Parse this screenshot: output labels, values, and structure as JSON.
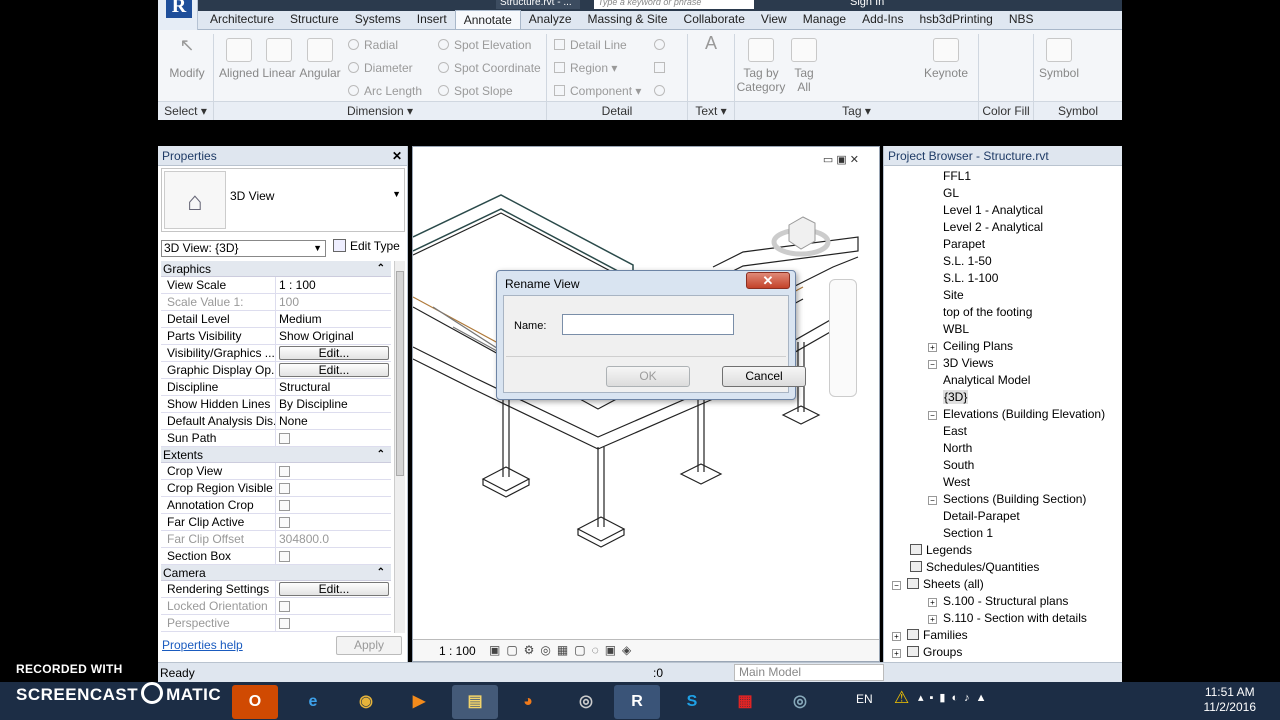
{
  "titlebar": {
    "file": "Structure.rvt - ...",
    "search_placeholder": "Type a keyword or phrase",
    "signin": "Sign In"
  },
  "tabs": [
    "Architecture",
    "Structure",
    "Systems",
    "Insert",
    "Annotate",
    "Analyze",
    "Massing & Site",
    "Collaborate",
    "View",
    "Manage",
    "Add-Ins",
    "hsb3dPrinting",
    "NBS"
  ],
  "active_tab": "Annotate",
  "ribbon": {
    "select": {
      "modify": "Modify",
      "panel": "Select ▾"
    },
    "dimension": {
      "aligned": "Aligned",
      "linear": "Linear",
      "angular": "Angular",
      "radial": "Radial",
      "diameter": "Diameter",
      "arc_length": "Arc Length",
      "spot_elevation": "Spot Elevation",
      "spot_coordinate": "Spot Coordinate",
      "spot_slope": "Spot Slope",
      "panel": "Dimension ▾"
    },
    "detail": {
      "detail_line": "Detail Line",
      "region": "Region ▾",
      "component": "Component ▾",
      "panel": "Detail"
    },
    "text": {
      "label": "Text ▾"
    },
    "tag": {
      "tag_by_category": "Tag by Category",
      "tag_all": "Tag All",
      "keynote": "Keynote",
      "panel": "Tag ▾"
    },
    "color_fill": {
      "panel": "Color Fill"
    },
    "symbol": {
      "symbol": "Symbol",
      "panel": "Symbol"
    }
  },
  "properties": {
    "header": "Properties",
    "type_name": "3D View",
    "view_selector": "3D View: {3D}",
    "edit_type": "Edit Type",
    "groups": [
      {
        "name": "Graphics",
        "rows": [
          {
            "k": "View Scale",
            "v": "1 : 100"
          },
          {
            "k": "Scale Value    1:",
            "v": "100",
            "dim": true
          },
          {
            "k": "Detail Level",
            "v": "Medium"
          },
          {
            "k": "Parts Visibility",
            "v": "Show Original"
          },
          {
            "k": "Visibility/Graphics ...",
            "v": "Edit...",
            "button": true
          },
          {
            "k": "Graphic Display Op...",
            "v": "Edit...",
            "button": true
          },
          {
            "k": "Discipline",
            "v": "Structural"
          },
          {
            "k": "Show Hidden Lines",
            "v": "By Discipline"
          },
          {
            "k": "Default Analysis Dis...",
            "v": "None"
          },
          {
            "k": "Sun Path",
            "v": "",
            "check": true
          }
        ]
      },
      {
        "name": "Extents",
        "rows": [
          {
            "k": "Crop View",
            "v": "",
            "check": true
          },
          {
            "k": "Crop Region Visible",
            "v": "",
            "check": true
          },
          {
            "k": "Annotation Crop",
            "v": "",
            "check": true
          },
          {
            "k": "Far Clip Active",
            "v": "",
            "check": true
          },
          {
            "k": "Far Clip Offset",
            "v": "304800.0",
            "dim": true
          },
          {
            "k": "Section Box",
            "v": "",
            "check": true
          }
        ]
      },
      {
        "name": "Camera",
        "rows": [
          {
            "k": "Rendering Settings",
            "v": "Edit...",
            "button": true
          },
          {
            "k": "Locked Orientation",
            "v": "",
            "check": true,
            "dim": true
          },
          {
            "k": "Perspective",
            "v": "",
            "check": true,
            "dim": true
          }
        ]
      }
    ],
    "help": "Properties help",
    "apply": "Apply"
  },
  "viewport": {
    "scale": "1 : 100"
  },
  "browser": {
    "header": "Project Browser - Structure.rvt",
    "nodes": [
      {
        "label": "FFL1",
        "indent": 3
      },
      {
        "label": "GL",
        "indent": 3
      },
      {
        "label": "Level 1 - Analytical",
        "indent": 3
      },
      {
        "label": "Level 2 - Analytical",
        "indent": 3
      },
      {
        "label": "Parapet",
        "indent": 3
      },
      {
        "label": "S.L. 1-50",
        "indent": 3
      },
      {
        "label": "S.L. 1-100",
        "indent": 3
      },
      {
        "label": "Site",
        "indent": 3
      },
      {
        "label": "top of the footing",
        "indent": 3
      },
      {
        "label": "WBL",
        "indent": 3
      },
      {
        "label": "Ceiling Plans",
        "indent": 2,
        "toggle": "+"
      },
      {
        "label": "3D Views",
        "indent": 2,
        "toggle": "-"
      },
      {
        "label": "Analytical Model",
        "indent": 3
      },
      {
        "label": "{3D}",
        "indent": 3,
        "selected": true
      },
      {
        "label": "Elevations (Building Elevation)",
        "indent": 2,
        "toggle": "-"
      },
      {
        "label": "East",
        "indent": 3
      },
      {
        "label": "North",
        "indent": 3
      },
      {
        "label": "South",
        "indent": 3
      },
      {
        "label": "West",
        "indent": 3
      },
      {
        "label": "Sections (Building Section)",
        "indent": 2,
        "toggle": "-"
      },
      {
        "label": "Detail-Parapet",
        "indent": 3
      },
      {
        "label": "Section 1",
        "indent": 3
      },
      {
        "label": "Legends",
        "indent": 1,
        "icon": true
      },
      {
        "label": "Schedules/Quantities",
        "indent": 1,
        "icon": true
      },
      {
        "label": "Sheets (all)",
        "indent": 0,
        "toggle": "-",
        "icon": true
      },
      {
        "label": "S.100 - Structural plans",
        "indent": 2,
        "toggle": "+"
      },
      {
        "label": "S.110 - Section with details",
        "indent": 2,
        "toggle": "+"
      },
      {
        "label": "Families",
        "indent": 0,
        "toggle": "+",
        "icon": true
      },
      {
        "label": "Groups",
        "indent": 0,
        "toggle": "+",
        "icon": true
      }
    ]
  },
  "dialog": {
    "title": "Rename View",
    "close": "✕",
    "name_label": "Name:",
    "name_value": "",
    "ok": "OK",
    "cancel": "Cancel"
  },
  "status": {
    "text": "Ready",
    "model": "Main Model",
    "count": ":0"
  },
  "taskbar": {
    "lang": "EN",
    "time": "11:51 AM",
    "date": "11/2/2016"
  },
  "watermark": {
    "line1": "RECORDED WITH",
    "line2a": "SCREENCAST",
    "line2b": "MATIC"
  }
}
